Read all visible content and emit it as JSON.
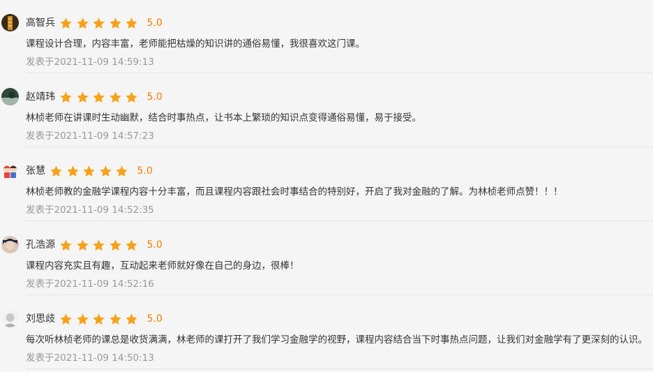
{
  "reviews": [
    {
      "name": "高智兵",
      "rating": 5,
      "score": "5.0",
      "content": "课程设计合理，内容丰富，老师能把枯燥的知识讲的通俗易懂，我很喜欢这门课。",
      "time": "发表于2021-11-09 14:59:13",
      "avatar_colors": [
        "#3a2a14",
        "#c98a2a"
      ]
    },
    {
      "name": "赵靖玮",
      "rating": 5,
      "score": "5.0",
      "content": "林桢老师在讲课时生动幽默，结合时事热点，让书本上繁琐的知识点变得通俗易懂，易于接受。",
      "time": "发表于2021-11-09 14:57:23",
      "avatar_colors": [
        "#2f4a3a",
        "#9fb6a8"
      ]
    },
    {
      "name": "张慧",
      "rating": 5,
      "score": "5.0",
      "content": "林桢老师教的金融学课程内容十分丰富，而且课程内容跟社会时事结合的特别好，开启了我对金融的了解。为林桢老师点赞！！！",
      "time": "发表于2021-11-09 14:52:35",
      "avatar_colors": [
        "#e8423a",
        "#f6d3b8"
      ]
    },
    {
      "name": "孔浩源",
      "rating": 5,
      "score": "5.0",
      "content": "课程内容充实且有趣，互动起来老师就好像在自己的身边，很棒！",
      "time": "发表于2021-11-09 14:52:16",
      "avatar_colors": [
        "#22284a",
        "#d8c6b6"
      ]
    },
    {
      "name": "刘思歧",
      "rating": 5,
      "score": "5.0",
      "content": "每次听林桢老师的课总是收货满满，林老师的课打开了我们学习金融学的视野，课程内容结合当下时事热点问题，让我们对金融学有了更深刻的认识。",
      "time": "发表于2021-11-09 14:50:13",
      "avatar_colors": [
        "#c8c8c8",
        "#f2f2f2"
      ]
    }
  ],
  "colors": {
    "star": "#f7a21b",
    "score": "#ff7a00",
    "time": "#999999",
    "divider": "#e4e4e4",
    "background": "#f5f5f5"
  },
  "icons": {
    "star": "star-icon",
    "avatar": "avatar"
  }
}
